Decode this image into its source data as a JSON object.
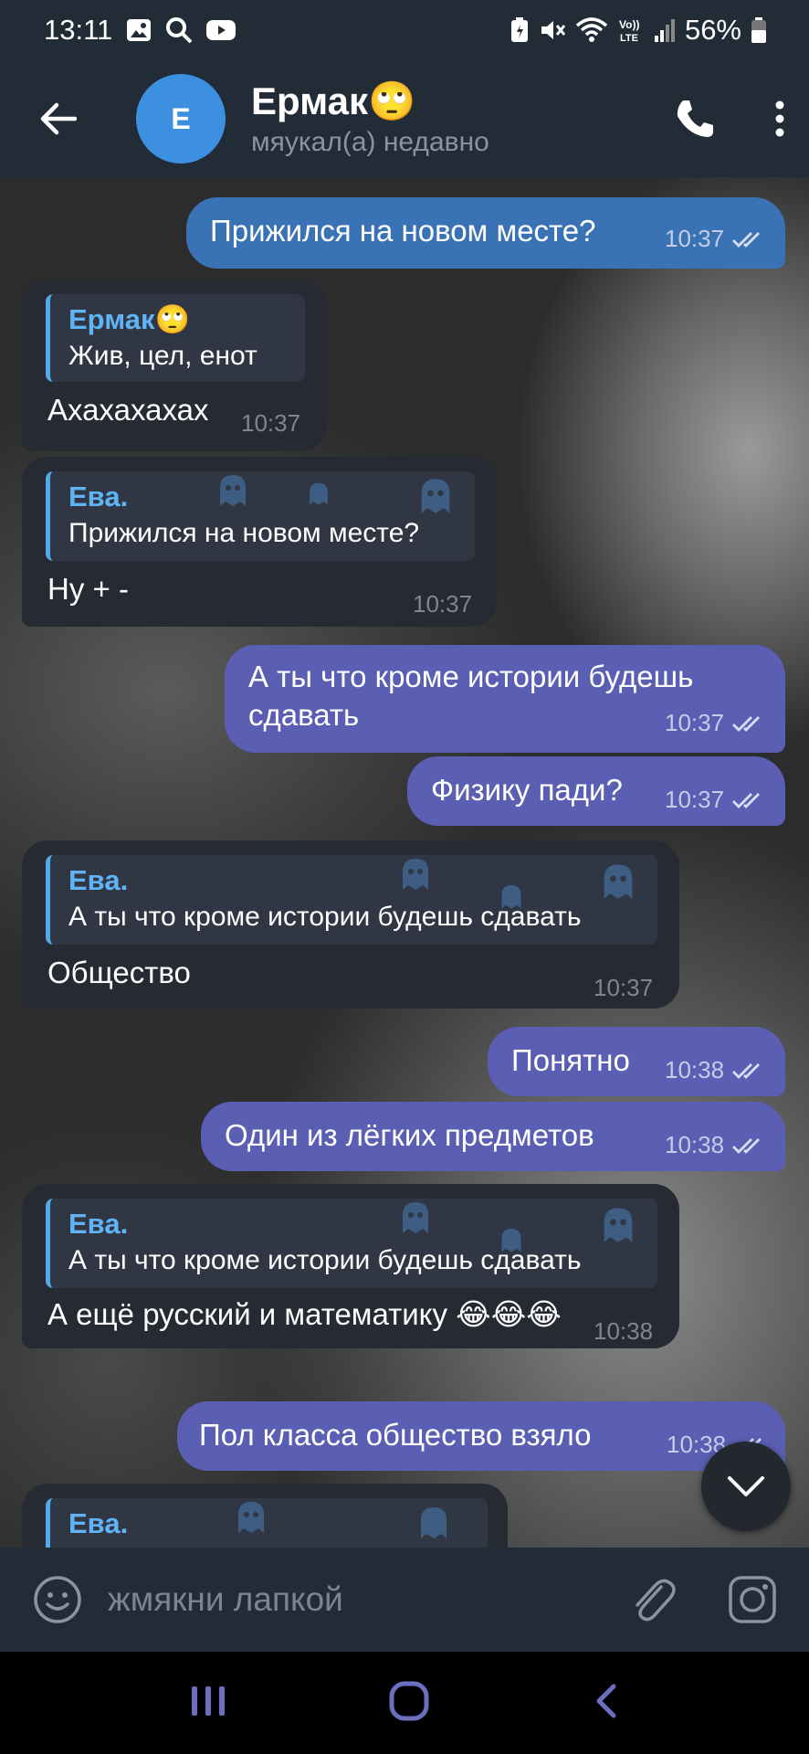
{
  "status_bar": {
    "time": "13:11",
    "battery": "56%",
    "icons": [
      "gallery-icon",
      "search-icon",
      "youtube-icon",
      "battery-saver-icon",
      "mute-icon",
      "wifi-icon",
      "volte-icon",
      "signal-icon",
      "battery-icon"
    ]
  },
  "header": {
    "title": "Ермак🙄",
    "status": "мяукал(а) недавно",
    "avatar_letter": "E",
    "avatar_color": "#3d8fdf"
  },
  "messages": [
    {
      "dir": "out",
      "text": "Прижился на новом месте?",
      "time": "10:37"
    },
    {
      "dir": "in",
      "reply_name": "Ермак🙄",
      "reply_text": "Жив, цел, енот",
      "text": "Ахахахахах",
      "time": "10:37"
    },
    {
      "dir": "in",
      "reply_name": "Ева.",
      "reply_text": "Прижился на новом месте?",
      "text": "Ну + -",
      "time": "10:37"
    },
    {
      "dir": "out",
      "text_line1": "А ты что кроме истории будешь",
      "text_line2": "сдавать",
      "time": "10:37"
    },
    {
      "dir": "out",
      "text": "Физику пади?",
      "time": "10:37"
    },
    {
      "dir": "in",
      "reply_name": "Ева.",
      "reply_text": "А ты что кроме истории будешь сдавать",
      "text": "Общество",
      "time": "10:37"
    },
    {
      "dir": "out",
      "text": "Понятно",
      "time": "10:38"
    },
    {
      "dir": "out",
      "text": "Один из лёгких предметов",
      "time": "10:38"
    },
    {
      "dir": "in",
      "reply_name": "Ева.",
      "reply_text": "А ты что кроме истории будешь сдавать",
      "text": "А ещё русский и математику 😂😂😂",
      "time": "10:38"
    },
    {
      "dir": "out",
      "text": "Пол класса общество взяло",
      "time": "10:38"
    },
    {
      "dir": "in",
      "reply_name": "Ева.",
      "reply_text": "",
      "text": "",
      "time": ""
    }
  ],
  "composer": {
    "placeholder": "жмякни лапкой"
  },
  "colors": {
    "header_bg": "#212c36",
    "out_bubble": "#5a5fb3",
    "in_bubble": "#262a33",
    "reply_accent": "#54a9eb"
  }
}
